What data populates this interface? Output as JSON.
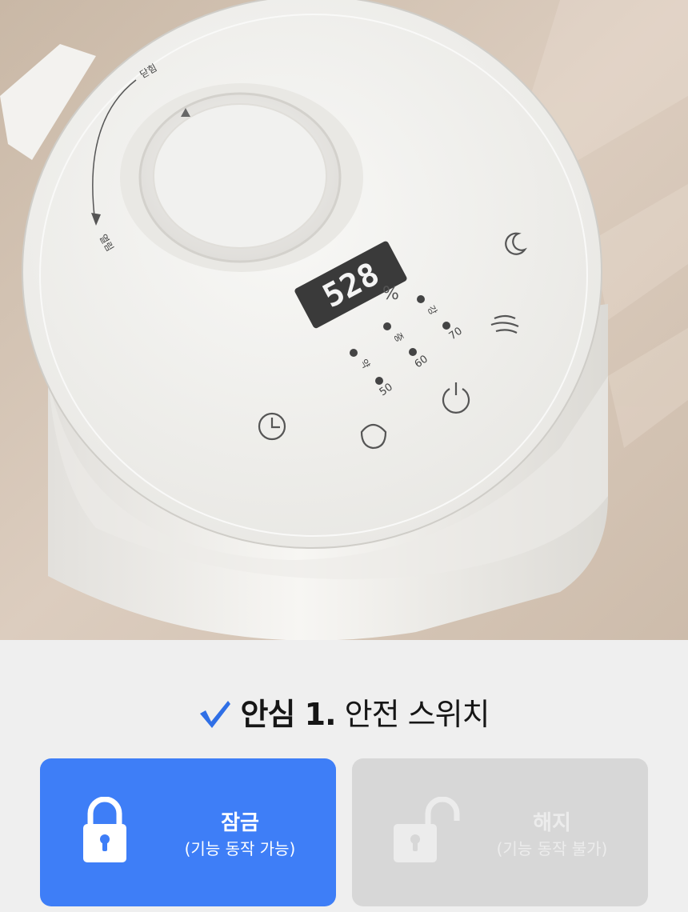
{
  "product_photo": {
    "display_value": "528",
    "display_unit": "%",
    "lid_label_close": "닫힘",
    "lid_label_open": "열림",
    "level_labels": [
      "강",
      "중",
      "약"
    ],
    "humidity_labels": [
      "70",
      "60",
      "50"
    ]
  },
  "headline": {
    "prefix": "안심 1.",
    "text": "안전 스위치"
  },
  "cards": [
    {
      "title": "잠금",
      "subtitle": "(기능 동작 가능)",
      "state": "active",
      "icon": "lock-closed-icon",
      "color": "#3e7ef7"
    },
    {
      "title": "해지",
      "subtitle": "(기능 동작 불가)",
      "state": "inactive",
      "icon": "lock-open-icon",
      "color": "#d7d7d7"
    }
  ],
  "accent_color": "#2f6fe6"
}
